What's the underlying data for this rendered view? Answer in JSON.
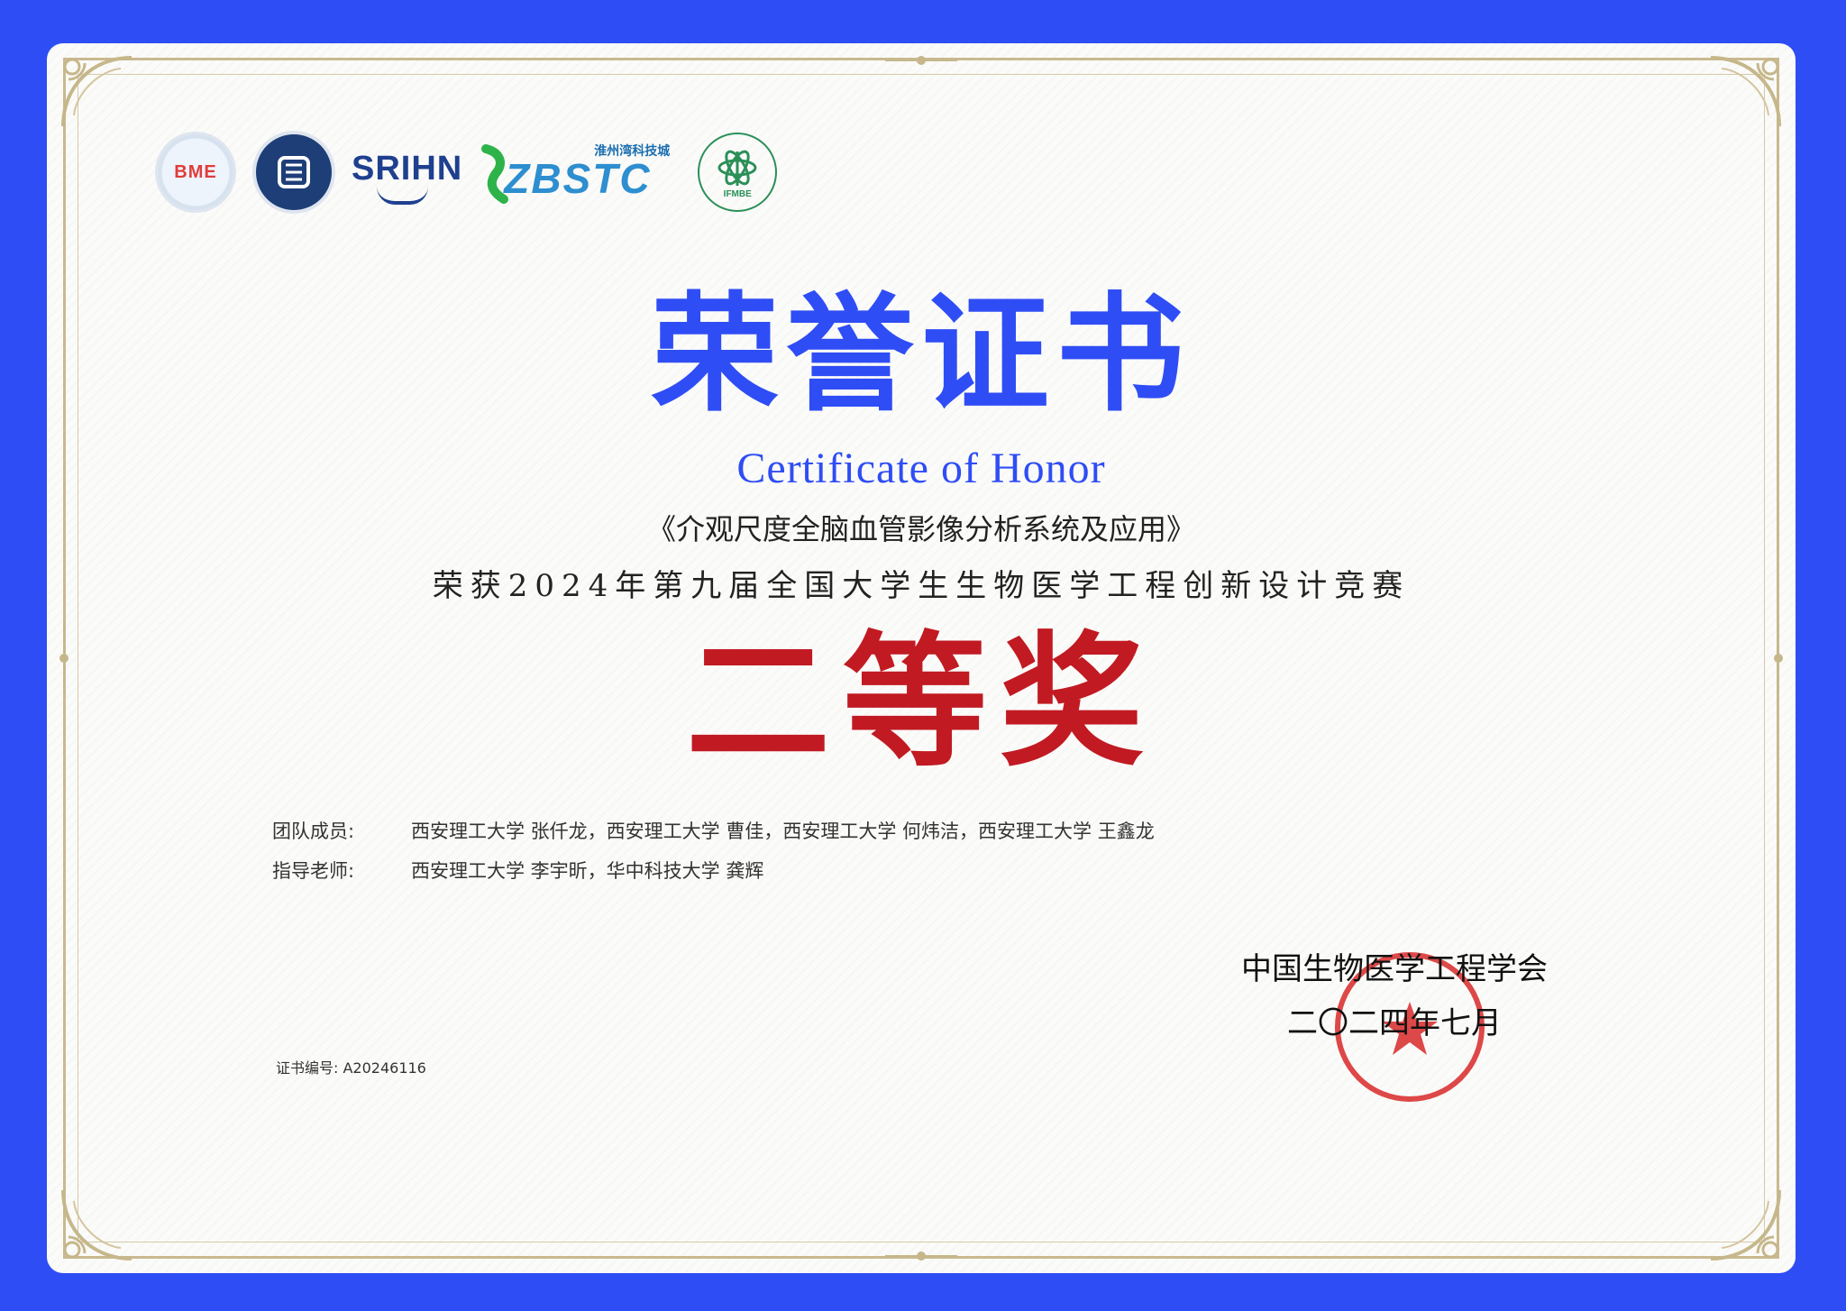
{
  "logos": {
    "bme_text": "BME",
    "srihn_text": "SRIHN",
    "zbstc_text": "ZBSTC",
    "zbstc_cn": "淮州湾科技城",
    "ifmbe_text": "IFMBE"
  },
  "certificate": {
    "title_cn": "荣誉证书",
    "title_en": "Certificate of Honor",
    "project": "《介观尺度全脑血管影像分析系统及应用》",
    "competition": "荣获2024年第九届全国大学生生物医学工程创新设计竞赛",
    "award": "二等奖"
  },
  "members": {
    "team_label": "团队成员:",
    "team_value": "西安理工大学 张仟龙，西安理工大学 曹佳，西安理工大学 何炜洁，西安理工大学 王鑫龙",
    "advisor_label": "指导老师:",
    "advisor_value": "西安理工大学 李宇昕，华中科技大学 龚辉"
  },
  "certificate_no": "证书编号: A20246116",
  "issuer": {
    "org": "中国生物医学工程学会",
    "date": "二〇二四年七月"
  },
  "seal_text": "中国生物医学工程学会",
  "colors": {
    "border_blue": "#2f4df5",
    "title_blue": "#2f4df5",
    "award_red": "#c11a22",
    "seal_red": "#d72424"
  }
}
